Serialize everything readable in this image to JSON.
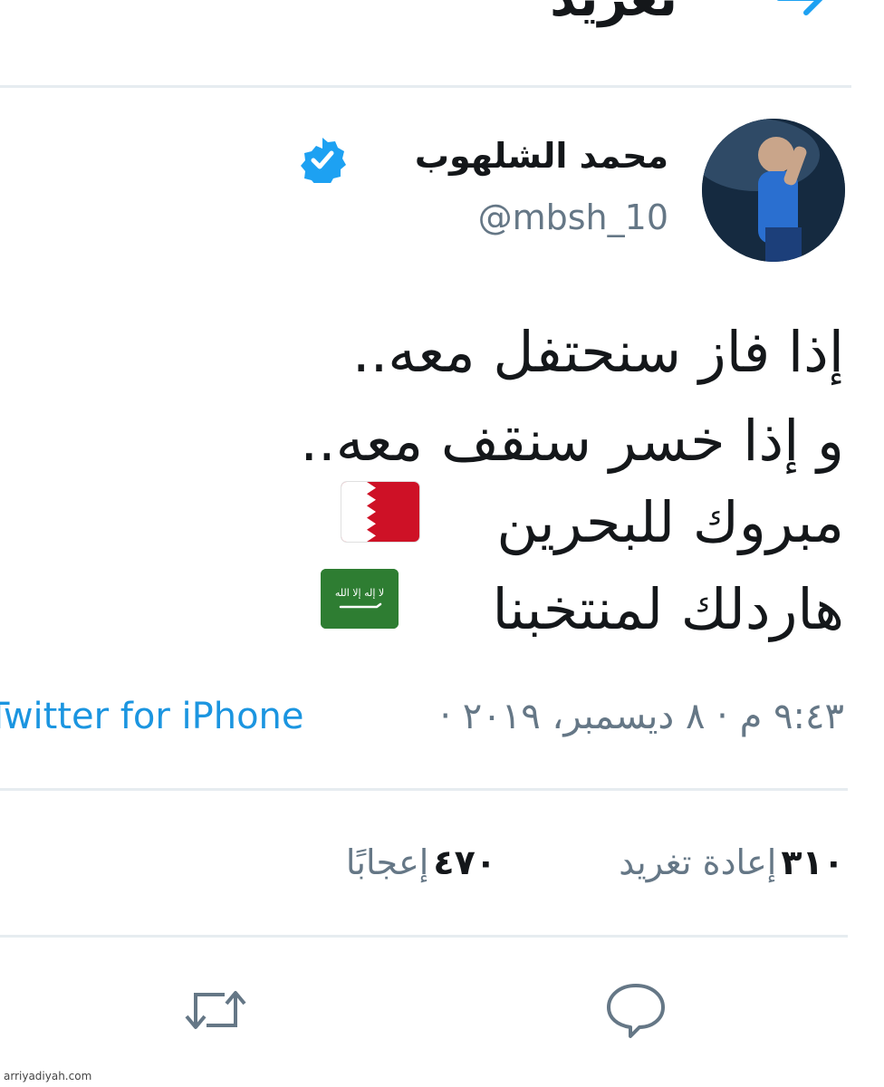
{
  "header": {
    "title": "تغريد",
    "back_icon": "arrow-right-icon"
  },
  "tweet": {
    "author_name": "محمد الشلهوب",
    "handle": "@mbsh_10",
    "verified_icon": "verified-badge-icon",
    "lines": [
      "إذا فاز سنحتفل معه..",
      "و إذا خسر سنقف معه..",
      "مبروك للبحرين",
      "هاردلك لمنتخبنا"
    ],
    "flags": {
      "bahrain": "bahrain-flag-icon",
      "saudi": "saudi-flag-icon",
      "saudi_text": "لا إله إلا الله"
    },
    "timestamp": "٩:٤٣ م · ٨ ديسمبر، ٢٠١٩ ·",
    "source": "Twitter for iPhone"
  },
  "stats": {
    "retweets_count": "٣١٠",
    "retweets_label": "إعادة تغريد",
    "likes_count": "٤٧٠",
    "likes_label": "إعجابًا"
  },
  "actions": {
    "reply_icon": "reply-icon",
    "retweet_icon": "retweet-icon"
  },
  "footer": {
    "watermark": "arriyadiyah.com"
  },
  "colors": {
    "text": "#14171a",
    "secondary": "#657786",
    "link": "#1b95e0",
    "verified": "#1da1f2",
    "divider": "#e6ecf0",
    "bahrain_red": "#ce1126",
    "saudi_green": "#2e7d32"
  }
}
